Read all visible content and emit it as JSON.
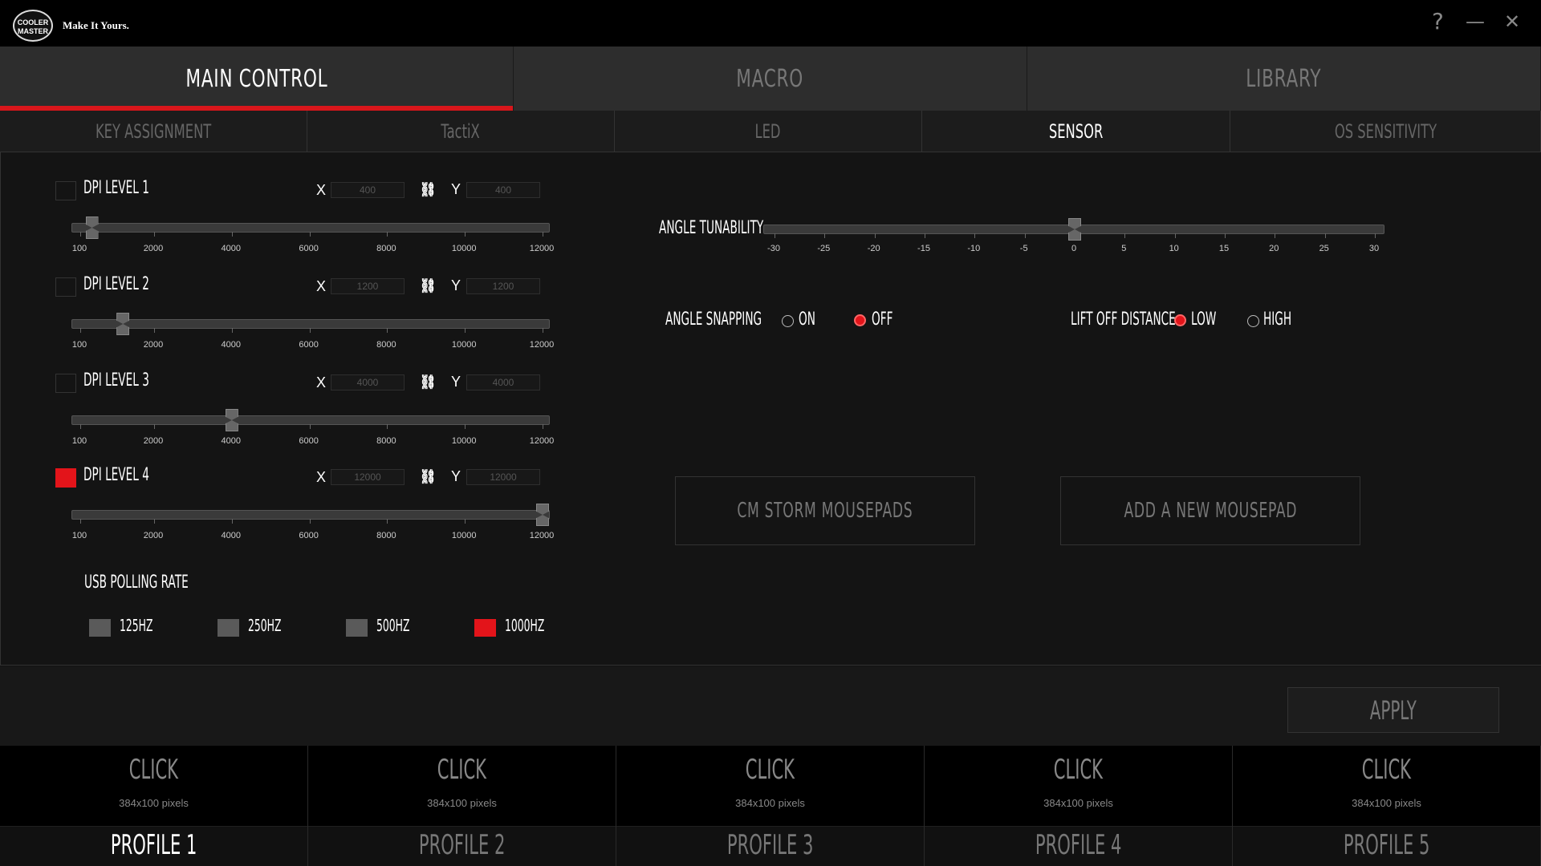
{
  "titlebar": {
    "logo_line1": "COOLER",
    "logo_line2": "MASTER",
    "tagline": "Make It Yours.",
    "help": "?",
    "minimize": "—",
    "close": "✕"
  },
  "main_tabs": [
    "MAIN CONTROL",
    "MACRO",
    "LIBRARY"
  ],
  "sub_tabs": [
    "KEY ASSIGNMENT",
    "TactiX",
    "LED",
    "SENSOR",
    "OS SENSITIVITY"
  ],
  "dpi_ticks": [
    "100",
    "2000",
    "4000",
    "6000",
    "8000",
    "10000",
    "12000"
  ],
  "dpi_levels": [
    {
      "label": "DPI LEVEL 1",
      "x": "400",
      "y": "400",
      "value": 400,
      "active": false
    },
    {
      "label": "DPI LEVEL 2",
      "x": "1200",
      "y": "1200",
      "value": 1200,
      "active": false
    },
    {
      "label": "DPI LEVEL 3",
      "x": "4000",
      "y": "4000",
      "value": 4000,
      "active": false
    },
    {
      "label": "DPI LEVEL 4",
      "x": "12000",
      "y": "12000",
      "value": 12000,
      "active": true
    }
  ],
  "axis_x": "X",
  "axis_y": "Y",
  "usb_polling": {
    "title": "USB POLLING RATE",
    "options": [
      {
        "label": "125HZ",
        "selected": false
      },
      {
        "label": "250HZ",
        "selected": false
      },
      {
        "label": "500HZ",
        "selected": false
      },
      {
        "label": "1000HZ",
        "selected": true
      }
    ]
  },
  "angle_tunability": {
    "label": "ANGLE TUNABILITY",
    "ticks": [
      "-30",
      "-25",
      "-20",
      "-15",
      "-10",
      "-5",
      "0",
      "5",
      "10",
      "15",
      "20",
      "25",
      "30"
    ],
    "value": 0
  },
  "angle_snapping": {
    "label": "ANGLE SNAPPING",
    "on": "ON",
    "off": "OFF",
    "selected": "OFF"
  },
  "lift_off": {
    "label": "LIFT OFF DISTANCE",
    "low": "LOW",
    "high": "HIGH",
    "selected": "LOW"
  },
  "buttons": {
    "mousepads": "CM STORM MOUSEPADS",
    "add_mousepad": "ADD A NEW MOUSEPAD",
    "apply": "APPLY"
  },
  "profiles": [
    {
      "click": "CLICK",
      "pixels": "384x100 pixels",
      "name": "PROFILE 1"
    },
    {
      "click": "CLICK",
      "pixels": "384x100 pixels",
      "name": "PROFILE 2"
    },
    {
      "click": "CLICK",
      "pixels": "384x100 pixels",
      "name": "PROFILE 3"
    },
    {
      "click": "CLICK",
      "pixels": "384x100 pixels",
      "name": "PROFILE 4"
    },
    {
      "click": "CLICK",
      "pixels": "384x100 pixels",
      "name": "PROFILE 5"
    }
  ],
  "colors": {
    "accent": "#e3141a",
    "background": "#141414",
    "titlebar": "#000000"
  }
}
